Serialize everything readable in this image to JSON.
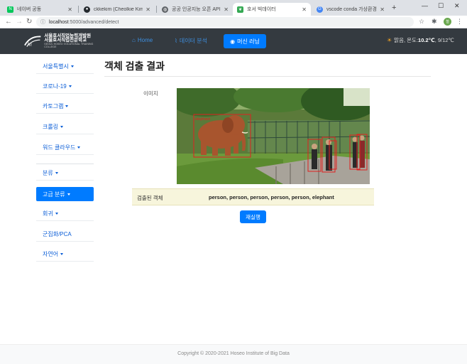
{
  "browser": {
    "tabs": [
      {
        "label": "네이버 공동",
        "favicon": "naver-icon",
        "color": "#03c75a",
        "active": false
      },
      {
        "label": "ckkekim (Cheolkie Kim)",
        "favicon": "github-icon",
        "color": "#24292e",
        "active": false
      },
      {
        "label": "공공 인공지능 오픈 API·DATA",
        "favicon": "globe-icon",
        "color": "#5f6368",
        "active": false
      },
      {
        "label": "호서 빅데이터",
        "favicon": "leaf-icon",
        "color": "#34a853",
        "active": true
      },
      {
        "label": "vscode conda 가상환경 - Google",
        "favicon": "google-icon",
        "color": "#4285f4",
        "active": false
      }
    ],
    "new_tab": "+",
    "url_host": "localhost",
    "url_path": ":5000/advanced/detect",
    "profile_initials": "철"
  },
  "site": {
    "logo_line1": "서울호서직업능력개발원",
    "logo_line2": "서울호서직업전문학교",
    "logo_line3": "SEOUL HOSEO VOCATIONAL TRAINING COLLEGE",
    "nav": [
      {
        "label": "Home",
        "icon": "home-icon"
      },
      {
        "label": "데이터 분석",
        "icon": "chart-icon"
      }
    ],
    "nav_active": {
      "label": "머신 러닝",
      "icon": "brain-icon"
    },
    "weather": {
      "text": "맑음, 온도: ",
      "temp": "10.2℃",
      "range": ", 9/12℃"
    }
  },
  "sidebar": {
    "items": [
      {
        "label": "서울특별시",
        "caret": true
      },
      {
        "label": "코로나-19",
        "caret": true
      },
      {
        "label": "카토그램",
        "caret": true
      },
      {
        "label": "크롤링",
        "caret": true
      },
      {
        "label": "워드 클라우드",
        "caret": true
      },
      {
        "label": "분류",
        "caret": true
      },
      {
        "label": "고급 분류",
        "caret": true
      },
      {
        "label": "회귀",
        "caret": true
      },
      {
        "label": "군집화/PCA",
        "caret": false
      },
      {
        "label": "자연어",
        "caret": true
      }
    ]
  },
  "main": {
    "title": "객체 검출 결과",
    "image_label": "이미지",
    "detect_label": "검출된 객체",
    "detected_objects": "person, person, person, person, person, elephant",
    "box_label": "elephant",
    "rerun": "재실행"
  },
  "footer": {
    "copyright": "Copyright © 2020-2021 Hoseo Institute of Big Data"
  },
  "colors": {
    "primary": "#007bff",
    "navbar": "#343a40",
    "result_bg": "#f7f5dc",
    "box": "#e02020"
  }
}
